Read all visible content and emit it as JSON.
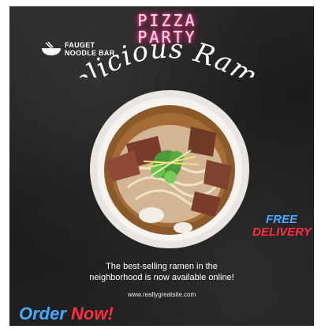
{
  "neon_sign": {
    "line1": "PIZZA",
    "line2": "PARTY"
  },
  "brand": {
    "line1": "FAUGET",
    "line2": "NOODLE BAR",
    "icon": "noodle-bowl-icon"
  },
  "title": "Delicious Ramen",
  "promo": {
    "line1": "FREE",
    "line2": "DELIVERY"
  },
  "tagline": {
    "line1": "The best-selling ramen in the",
    "line2": "neighborhood is now available online!"
  },
  "website": "www.reallygreatsite.com",
  "cta": {
    "word1": "Order",
    "word2": "Now!"
  },
  "colors": {
    "neon": "#ff2a7f",
    "accent_blue": "#4aa8ff",
    "accent_red": "#ff2d3f",
    "background": "#1f1f1f"
  }
}
